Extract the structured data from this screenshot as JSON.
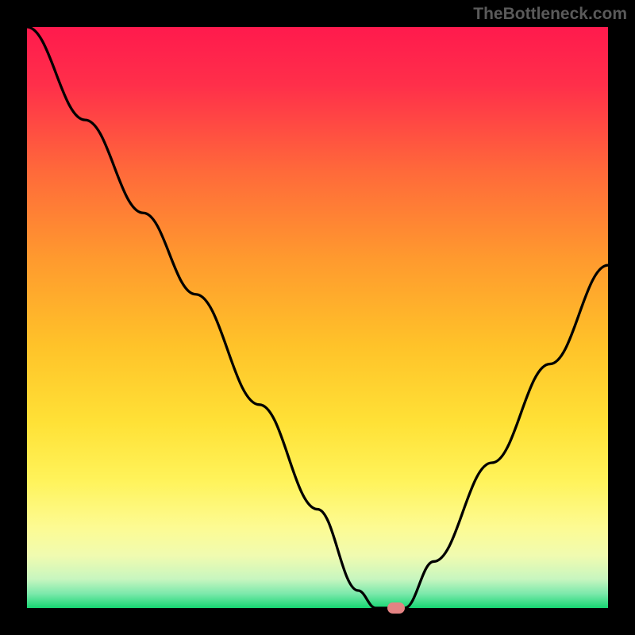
{
  "watermark": "TheBottleneck.com",
  "chart_data": {
    "type": "line",
    "title": "",
    "xlabel": "",
    "ylabel": "",
    "xlim": [
      0,
      100
    ],
    "ylim": [
      0,
      100
    ],
    "curve": {
      "x": [
        0,
        10,
        20,
        29,
        40,
        50,
        57,
        60,
        62,
        65,
        70,
        80,
        90,
        100
      ],
      "y": [
        100,
        84,
        68,
        54,
        35,
        17,
        3,
        0,
        0,
        0,
        8,
        25,
        42,
        59
      ]
    },
    "marker": {
      "x": 63.5,
      "y": 0
    },
    "gradient_stops": [
      {
        "pos": 0.0,
        "color": "#ff1a4d"
      },
      {
        "pos": 0.1,
        "color": "#ff2f4a"
      },
      {
        "pos": 0.25,
        "color": "#ff6a3a"
      },
      {
        "pos": 0.4,
        "color": "#ff9a2e"
      },
      {
        "pos": 0.55,
        "color": "#ffc329"
      },
      {
        "pos": 0.68,
        "color": "#ffe136"
      },
      {
        "pos": 0.78,
        "color": "#fff35a"
      },
      {
        "pos": 0.86,
        "color": "#fdfb92"
      },
      {
        "pos": 0.91,
        "color": "#f0fbb0"
      },
      {
        "pos": 0.95,
        "color": "#c8f6bf"
      },
      {
        "pos": 0.975,
        "color": "#7de9ac"
      },
      {
        "pos": 1.0,
        "color": "#17d672"
      }
    ]
  }
}
